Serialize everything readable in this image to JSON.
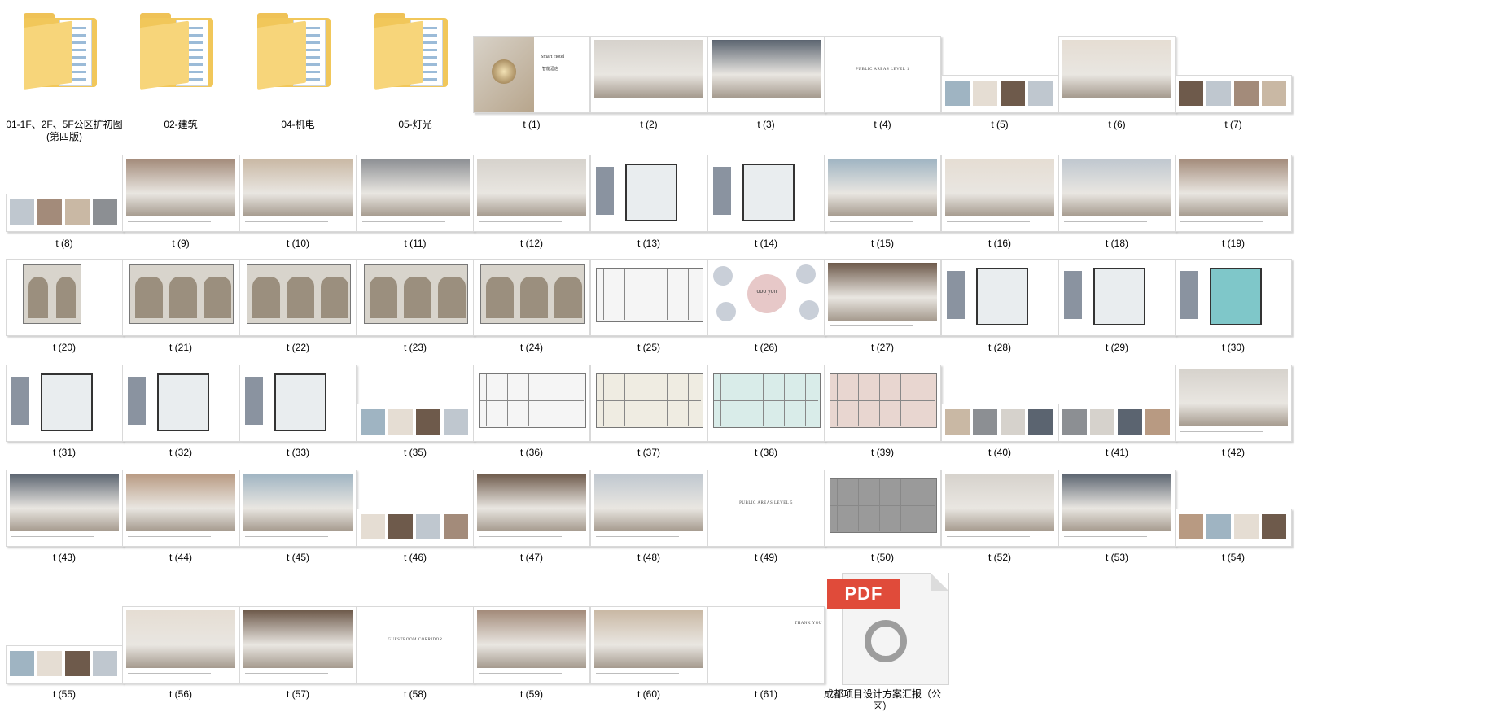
{
  "folders": [
    {
      "name": "01-1F、2F、5F公区扩初图(第四版)"
    },
    {
      "name": "02-建筑"
    },
    {
      "name": "04-机电"
    },
    {
      "name": "05-灯光"
    }
  ],
  "files": [
    "t (1)",
    "t (2)",
    "t (3)",
    "t (4)",
    "t (5)",
    "t (6)",
    "t (7)",
    "t (8)",
    "t (9)",
    "t (10)",
    "t (11)",
    "t (12)",
    "t (13)",
    "t (14)",
    "t (15)",
    "t (16)",
    "t (18)",
    "t (19)",
    "t (20)",
    "t (21)",
    "t (22)",
    "t (23)",
    "t (24)",
    "t (25)",
    "t (26)",
    "t (27)",
    "t (28)",
    "t (29)",
    "t (30)",
    "t (31)",
    "t (32)",
    "t (33)",
    "t (35)",
    "t (36)",
    "t (37)",
    "t (38)",
    "t (39)",
    "t (40)",
    "t (41)",
    "t (42)",
    "t (43)",
    "t (44)",
    "t (45)",
    "t (46)",
    "t (47)",
    "t (48)",
    "t (49)",
    "t (50)",
    "t (52)",
    "t (53)",
    "t (54)",
    "t (55)",
    "t (56)",
    "t (57)",
    "t (58)",
    "t (59)",
    "t (60)",
    "t (61)"
  ],
  "pdf": {
    "badge": "PDF",
    "name": "成都项目设计方案汇报（公区）"
  },
  "thumb_text": {
    "t1_title": "Smart Hotel",
    "t1_sub": "智能酒店",
    "t4_title": "PUBLIC AREAS LEVEL 1",
    "t49_title": "PUBLIC AREAS LEVEL 5",
    "t58_title": "GUESTROOM CORRIDOR",
    "t61_title": "THANK YOU",
    "t26_logo": "ooo yon"
  },
  "colors": {
    "folder": "#f1c75a",
    "pdf_red": "#e04b3a"
  }
}
